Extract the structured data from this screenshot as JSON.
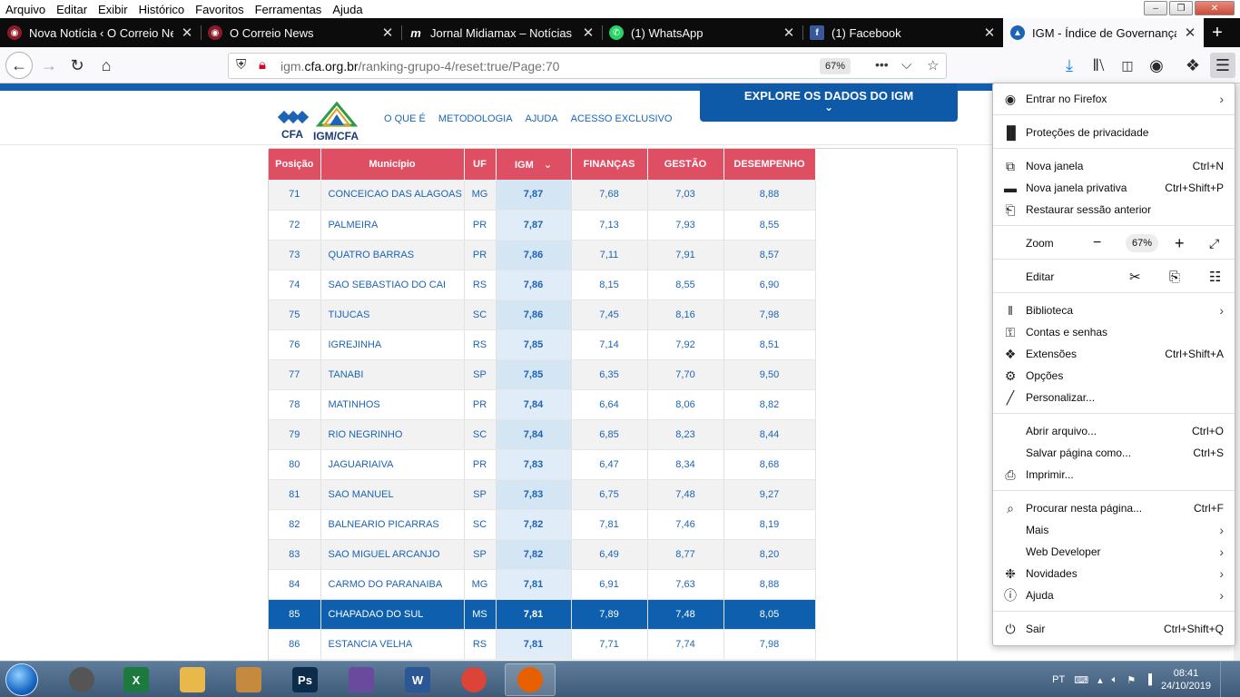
{
  "menubar": [
    "Arquivo",
    "Editar",
    "Exibir",
    "Histórico",
    "Favoritos",
    "Ferramentas",
    "Ajuda"
  ],
  "tabs": [
    {
      "title": "Nova Notícia ‹ O Correio News",
      "icon": "correio-news-icon",
      "color": "#8a1c2a"
    },
    {
      "title": "O Correio News",
      "icon": "correio-news-icon",
      "color": "#8a1c2a"
    },
    {
      "title": "Jornal Midiamax – Notícias de",
      "icon": "midiamax-icon",
      "color": "#0c0c0d"
    },
    {
      "title": "(1) WhatsApp",
      "icon": "whatsapp-icon",
      "color": "#25d366"
    },
    {
      "title": "(1) Facebook",
      "icon": "facebook-icon",
      "color": "#3b5998"
    },
    {
      "title": "IGM - Índice de Governança M",
      "icon": "igm-icon",
      "color": "#1c64b5"
    }
  ],
  "url": {
    "host_prefix": "igm.",
    "host": "cfa.org.br",
    "path": "/ranking-grupo-4/reset:true/Page:70",
    "zoom": "67%"
  },
  "site": {
    "logo_cfa": "CFA",
    "logo_igm": "IGM/CFA",
    "nav": [
      "O QUE É",
      "METODOLOGIA",
      "AJUDA",
      "ACESSO EXCLUSIVO"
    ],
    "explore": "EXPLORE OS DADOS DO IGM"
  },
  "table": {
    "headers": [
      "Posição",
      "Município",
      "UF",
      "IGM",
      "FINANÇAS",
      "GESTÃO",
      "DESEMPENHO"
    ],
    "highlight_position": "85",
    "rows": [
      [
        "71",
        "CONCEICAO DAS ALAGOAS",
        "MG",
        "7,87",
        "7,68",
        "7,03",
        "8,88"
      ],
      [
        "72",
        "PALMEIRA",
        "PR",
        "7,87",
        "7,13",
        "7,93",
        "8,55"
      ],
      [
        "73",
        "QUATRO BARRAS",
        "PR",
        "7,86",
        "7,11",
        "7,91",
        "8,57"
      ],
      [
        "74",
        "SAO SEBASTIAO DO CAI",
        "RS",
        "7,86",
        "8,15",
        "8,55",
        "6,90"
      ],
      [
        "75",
        "TIJUCAS",
        "SC",
        "7,86",
        "7,45",
        "8,16",
        "7,98"
      ],
      [
        "76",
        "IGREJINHA",
        "RS",
        "7,85",
        "7,14",
        "7,92",
        "8,51"
      ],
      [
        "77",
        "TANABI",
        "SP",
        "7,85",
        "6,35",
        "7,70",
        "9,50"
      ],
      [
        "78",
        "MATINHOS",
        "PR",
        "7,84",
        "6,64",
        "8,06",
        "8,82"
      ],
      [
        "79",
        "RIO NEGRINHO",
        "SC",
        "7,84",
        "6,85",
        "8,23",
        "8,44"
      ],
      [
        "80",
        "JAGUARIAIVA",
        "PR",
        "7,83",
        "6,47",
        "8,34",
        "8,68"
      ],
      [
        "81",
        "SAO MANUEL",
        "SP",
        "7,83",
        "6,75",
        "7,48",
        "9,27"
      ],
      [
        "82",
        "BALNEARIO PICARRAS",
        "SC",
        "7,82",
        "7,81",
        "7,46",
        "8,19"
      ],
      [
        "83",
        "SAO MIGUEL ARCANJO",
        "SP",
        "7,82",
        "6,49",
        "8,77",
        "8,20"
      ],
      [
        "84",
        "CARMO DO PARANAIBA",
        "MG",
        "7,81",
        "6,91",
        "7,63",
        "8,88"
      ],
      [
        "85",
        "CHAPADAO DO SUL",
        "MS",
        "7,81",
        "7,89",
        "7,48",
        "8,05"
      ],
      [
        "86",
        "ESTANCIA VELHA",
        "RS",
        "7,81",
        "7,71",
        "7,74",
        "7,98"
      ]
    ]
  },
  "ff_menu": {
    "sign_in": "Entrar no Firefox",
    "privacy": "Proteções de privacidade",
    "new_window": {
      "label": "Nova janela",
      "shortcut": "Ctrl+N"
    },
    "private_window": {
      "label": "Nova janela privativa",
      "shortcut": "Ctrl+Shift+P"
    },
    "restore": "Restaurar sessão anterior",
    "zoom": {
      "label": "Zoom",
      "value": "67%"
    },
    "edit": "Editar",
    "library": "Biblioteca",
    "logins": "Contas e senhas",
    "addons": {
      "label": "Extensões",
      "shortcut": "Ctrl+Shift+A"
    },
    "options": "Opções",
    "customize": "Personalizar...",
    "open_file": {
      "label": "Abrir arquivo...",
      "shortcut": "Ctrl+O"
    },
    "save_page": {
      "label": "Salvar página como...",
      "shortcut": "Ctrl+S"
    },
    "print": "Imprimir...",
    "find": {
      "label": "Procurar nesta página...",
      "shortcut": "Ctrl+F"
    },
    "more": "Mais",
    "web_dev": "Web Developer",
    "whats_new": "Novidades",
    "help": "Ajuda",
    "quit": {
      "label": "Sair",
      "shortcut": "Ctrl+Shift+Q"
    }
  },
  "taskbar": {
    "language": "PT",
    "time": "08:41",
    "date": "24/10/2019",
    "apps": [
      {
        "name": "chrome-remote-icon",
        "label": "",
        "color": "#555"
      },
      {
        "name": "excel-icon",
        "label": "X",
        "color": "#1d7a3e"
      },
      {
        "name": "explorer-icon",
        "label": "",
        "color": "#e8b84a"
      },
      {
        "name": "paint-icon",
        "label": "",
        "color": "#c58a3e"
      },
      {
        "name": "photoshop-icon",
        "label": "Ps",
        "color": "#0b2c4a"
      },
      {
        "name": "movie-maker-icon",
        "label": "",
        "color": "#6a4a9c"
      },
      {
        "name": "word-icon",
        "label": "W",
        "color": "#2b5797"
      },
      {
        "name": "chrome-icon",
        "label": "",
        "color": "#db4437"
      },
      {
        "name": "firefox-icon",
        "label": "",
        "color": "#e66000"
      }
    ]
  }
}
